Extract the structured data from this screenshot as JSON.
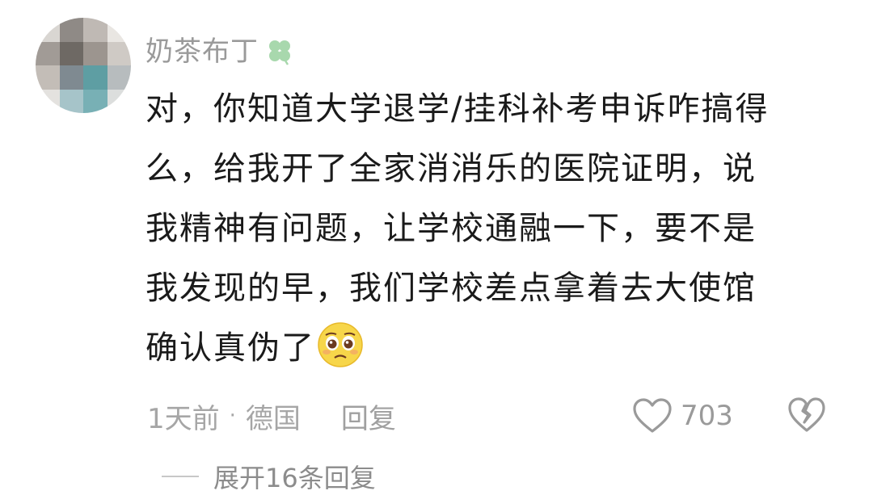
{
  "comment": {
    "username": "奶茶布丁",
    "username_badge_icon": "clover-icon",
    "lines": [
      "对，你知道大学退学/挂科补考申诉咋搞得",
      "么，给我开了全家消消乐的医院证明，说",
      "我精神有问题，让学校通融一下，要不是",
      "我发现的早，我们学校差点拿着去大使馆",
      "确认真伪了"
    ],
    "trailing_emoji": "pleading-face-emoji",
    "time": "1天前",
    "separator": "·",
    "location": "德国",
    "reply_label": "回复",
    "like_count": "703",
    "expand_replies_label": "展开16条回复"
  },
  "colors": {
    "text_primary": "#1a1a1a",
    "text_secondary": "#a6a6a6",
    "clover": "#9fd3a4"
  }
}
